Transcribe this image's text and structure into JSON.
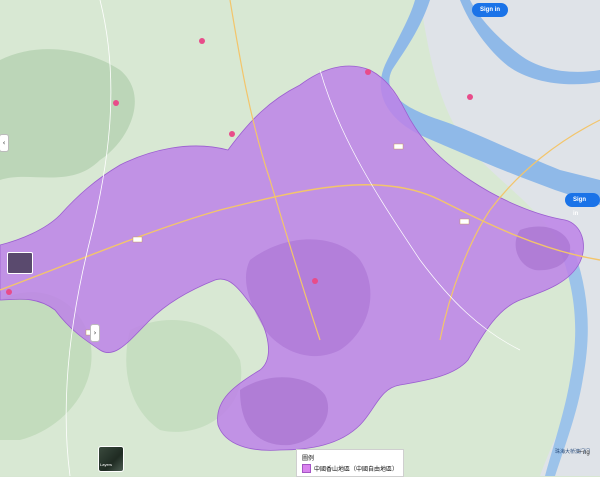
{
  "map": {
    "water_color": "#8fb9e8",
    "land_color": "#d7e6d2",
    "region_fill": "#bd82e8",
    "urban_color": "#c9cdd3"
  },
  "buttons": {
    "signin_top": "Sign in",
    "signin_right": "Sign in"
  },
  "side_tabs": {
    "left": "‹",
    "mid": "›"
  },
  "thumbnail": {
    "label": "Layers"
  },
  "legend": {
    "title": "圖例",
    "entry": "中國香山地區（中國自由地區）",
    "swatch_color": "#d983ee"
  },
  "corner": {
    "label": "一ng",
    "city_caption": "珠海大桥澳门门"
  },
  "icons": [
    "map-pin-icon",
    "road-shield-icon",
    "chevron-icon",
    "layers-icon"
  ]
}
